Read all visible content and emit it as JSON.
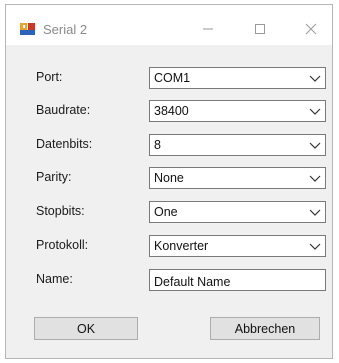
{
  "window": {
    "title": "Serial 2",
    "app_icon": "serial-app-icon",
    "controls": {
      "minimize_icon": "minimize-icon",
      "maximize_icon": "maximize-icon",
      "close_icon": "close-icon"
    }
  },
  "form": {
    "port": {
      "label": "Port:",
      "value": "COM1"
    },
    "baudrate": {
      "label": "Baudrate:",
      "value": "38400"
    },
    "datenbits": {
      "label": "Datenbits:",
      "value": "8"
    },
    "parity": {
      "label": "Parity:",
      "value": "None"
    },
    "stopbits": {
      "label": "Stopbits:",
      "value": "One"
    },
    "protokoll": {
      "label": "Protokoll:",
      "value": "Konverter"
    },
    "name": {
      "label": "Name:",
      "value": "Default Name"
    }
  },
  "buttons": {
    "ok_label": "OK",
    "cancel_label": "Abbrechen"
  },
  "colors": {
    "window_bg": "#f0f0f0",
    "titlebar_bg": "#ffffff",
    "border": "#7a7a7a"
  }
}
